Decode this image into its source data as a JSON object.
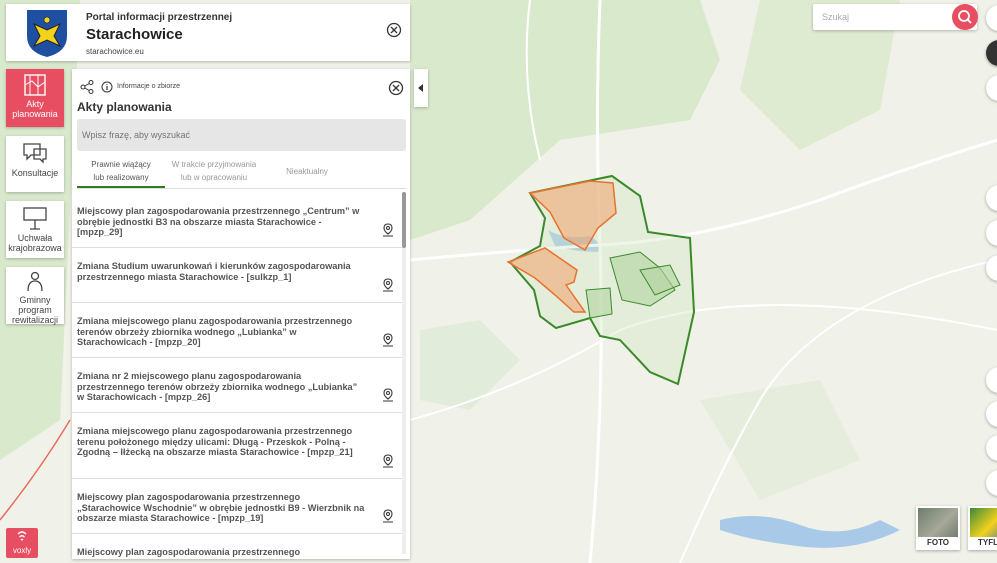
{
  "header": {
    "portal": "Portal informacji przestrzennej",
    "city": "Starachowice",
    "domain": "starachowice.eu"
  },
  "nav": [
    {
      "label": "Akty planowania",
      "icon": "document-map-icon",
      "active": true
    },
    {
      "label": "Konsultacje",
      "icon": "chat-bubbles-icon",
      "active": false
    },
    {
      "label": "Uchwała krajobrazowa",
      "icon": "billboard-icon",
      "active": false
    },
    {
      "label": "Gminny program rewitalizacji",
      "icon": "people-icon",
      "active": false
    }
  ],
  "panel": {
    "info_label": "Informacje o zbiorze",
    "title": "Akty planowania",
    "search_placeholder": "Wpisz frazę, aby wyszukać",
    "tabs": [
      {
        "line1": "Prawnie wiążący",
        "line2": "lub realizowany",
        "active": true
      },
      {
        "line1": "W trakcie przyjmowania",
        "line2": "lub w opracowaniu",
        "active": false
      },
      {
        "line1": "Nieaktualny",
        "line2": "",
        "active": false
      }
    ],
    "items": [
      "Miejscowy plan zagospodarowania przestrzennego „Centrum” w obrębie jednostki B3 na obszarze miasta Starachowice - [mpzp_29]",
      "Zmiana Studium uwarunkowań i kierunków zagospodarowania przestrzennego miasta Starachowice - [sulkzp_1]",
      "Zmiana miejscowego planu zagospodarowania przestrzennego terenów obrzeży zbiornika wodnego „Lubianka” w Starachowicach - [mpzp_20]",
      "Zmiana nr 2 miejscowego planu zagospodarowania przestrzennego terenów obrzeży zbiornika wodnego „Lubianka” w Starachowicach - [mpzp_26]",
      "Zmiana miejscowego planu zagospodarowania przestrzennego terenu położonego między ulicami: Długą - Przeskok - Polną - Zgodną – Iłżecką na obszarze miasta Starachowice - [mpzp_21]",
      "Miejscowy plan zagospodarowania przestrzennego „Starachowice Wschodnie” w obrębie jednostki B9 - Wierzbnik na obszarze miasta Starachowice - [mpzp_19]",
      "Miejscowy plan zagospodarowania przestrzennego"
    ]
  },
  "map": {
    "search_placeholder": "Szukaj",
    "thumb_foto": "FOTO",
    "thumb_tyflo": "TYFL"
  },
  "voxly": "voxly",
  "colors": {
    "accent": "#e84e62",
    "plan_outline": "#3a8a2a",
    "plan_highlight": "#e8732f"
  }
}
